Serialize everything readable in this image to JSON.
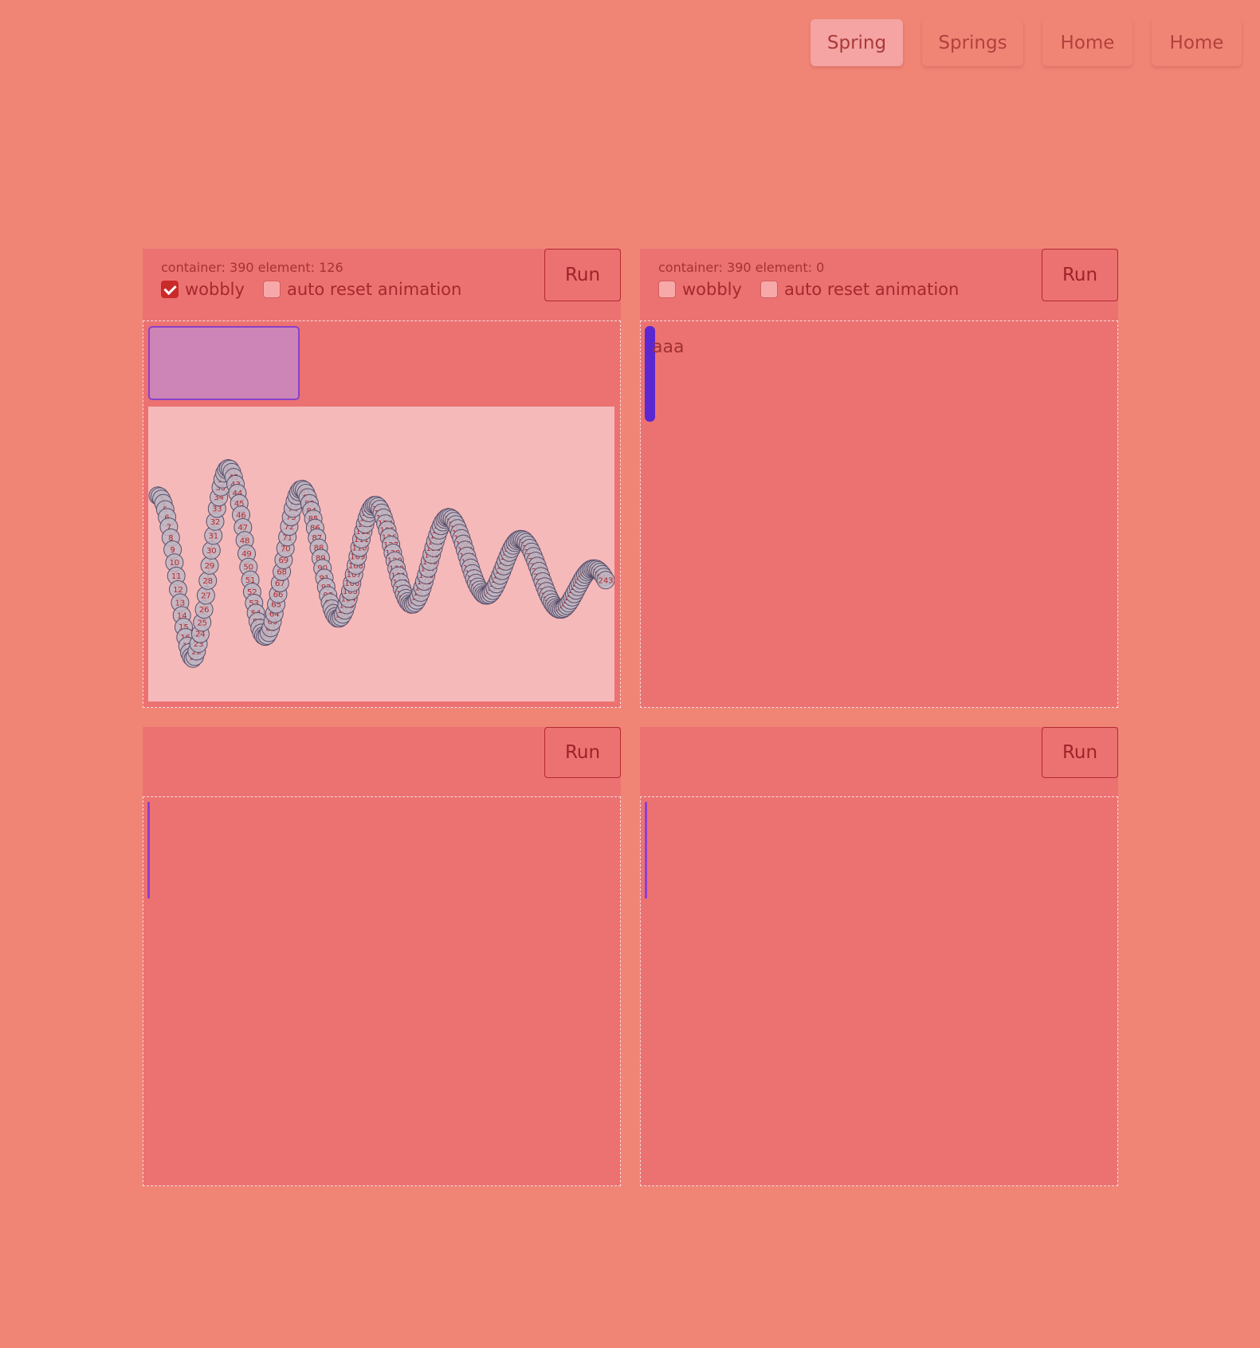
{
  "nav": {
    "items": [
      {
        "label": "Spring",
        "active": true
      },
      {
        "label": "Springs",
        "active": false
      },
      {
        "label": "Home",
        "active": false
      },
      {
        "label": "Home",
        "active": false
      }
    ]
  },
  "panels": [
    {
      "run_label": "Run",
      "info": "container: 390 element: 126",
      "wobbly_label": "wobbly",
      "wobbly_checked": true,
      "auto_reset_label": "auto reset animation",
      "auto_reset_checked": false
    },
    {
      "run_label": "Run",
      "info": "container: 390 element: 0",
      "wobbly_label": "wobbly",
      "wobbly_checked": false,
      "auto_reset_label": "auto reset animation",
      "auto_reset_checked": false,
      "body_text": "aaa"
    },
    {
      "run_label": "Run"
    },
    {
      "run_label": "Run"
    }
  ],
  "chart_data": {
    "type": "line",
    "title": "",
    "xlabel": "",
    "ylabel": "",
    "frames": 243,
    "point_labels_shown": true,
    "series": [
      {
        "style": "red curve with numbered grey circle markers per frame"
      }
    ]
  },
  "colors": {
    "background": "#f08576",
    "panel": "#ec7272",
    "chart_bg": "#f6b9b9",
    "curve": "#e01818",
    "marker_fill": "#bfb6c2",
    "marker_stroke": "#5a4e6a",
    "accent_purple": "#5b27d0"
  }
}
